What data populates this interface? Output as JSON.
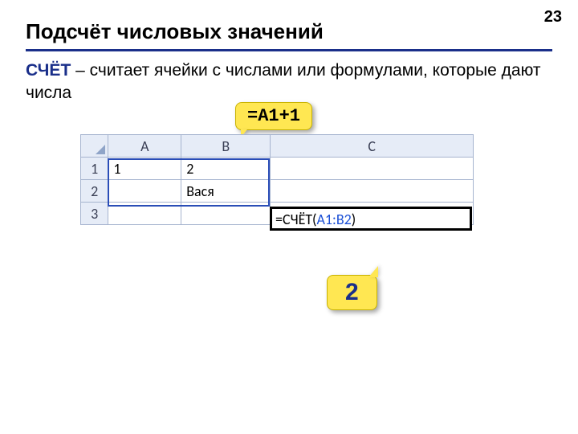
{
  "page_number": "23",
  "title": "Подсчёт числовых значений",
  "func_name": "СЧЁТ",
  "desc_rest": " – считает ячейки с числами или формулами, которые дают числа",
  "formula_callout": "=A1+1",
  "result_callout": "2",
  "sheet": {
    "col_labels": {
      "A": "A",
      "B": "B",
      "C": "C"
    },
    "row_labels": {
      "r1": "1",
      "r2": "2",
      "r3": "3"
    },
    "cells": {
      "A1": "1",
      "B1": "2",
      "C1": "",
      "A2": "",
      "B2": "Вася",
      "C2": "",
      "A3": "",
      "B3": "",
      "C3_prefix": "=СЧЁТ(",
      "C3_range": "A1:B2",
      "C3_suffix": ")"
    }
  }
}
